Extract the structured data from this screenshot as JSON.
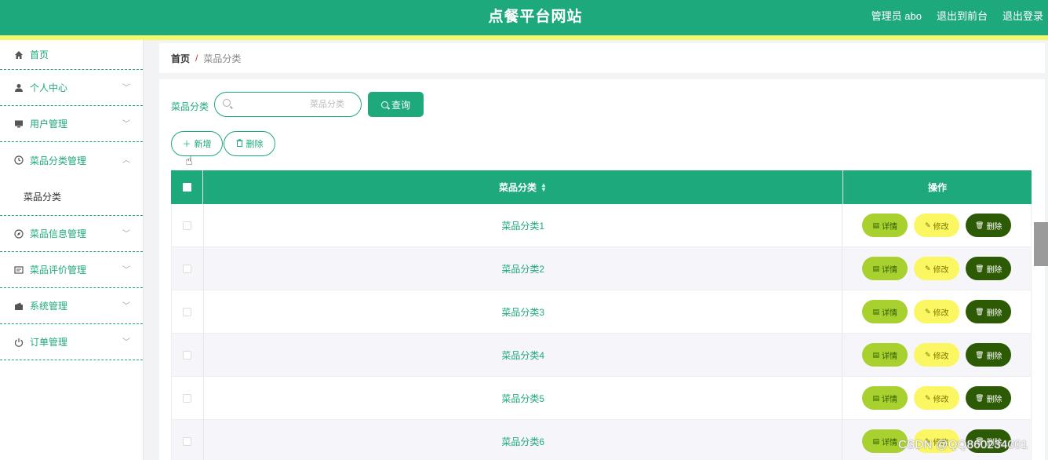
{
  "header": {
    "title": "点餐平台网站",
    "links": [
      "管理员 abo",
      "退出到前台",
      "退出登录"
    ]
  },
  "sidebar": {
    "items": [
      {
        "label": "首页",
        "icon": "home-icon"
      },
      {
        "label": "个人中心",
        "icon": "user-icon"
      },
      {
        "label": "用户管理",
        "icon": "monitor-icon"
      },
      {
        "label": "菜品分类管理",
        "icon": "clock-icon",
        "expanded": true,
        "sub": [
          "菜品分类"
        ]
      },
      {
        "label": "菜品信息管理",
        "icon": "compass-icon"
      },
      {
        "label": "菜品评价管理",
        "icon": "message-icon"
      },
      {
        "label": "系统管理",
        "icon": "wallet-icon"
      },
      {
        "label": "订单管理",
        "icon": "power-icon"
      }
    ]
  },
  "breadcrumb": {
    "home": "首页",
    "sep": "/",
    "current": "菜品分类"
  },
  "search": {
    "label": "菜品分类",
    "placeholder": "菜品分类",
    "button": "查询"
  },
  "actions": {
    "add": "新增",
    "delete": "删除"
  },
  "table": {
    "headers": {
      "name": "菜品分类",
      "op": "操作"
    },
    "rows": [
      "菜品分类1",
      "菜品分类2",
      "菜品分类3",
      "菜品分类4",
      "菜品分类5",
      "菜品分类6"
    ],
    "row_actions": {
      "detail": "详情",
      "edit": "修改",
      "remove": "删除"
    }
  },
  "watermark": "CSDN @QQ860234001",
  "colors": {
    "primary": "#1ea97c",
    "stripe": "#f5f76a",
    "detail": "#a8d12f",
    "edit": "#fbf763",
    "remove": "#2d5a05"
  }
}
